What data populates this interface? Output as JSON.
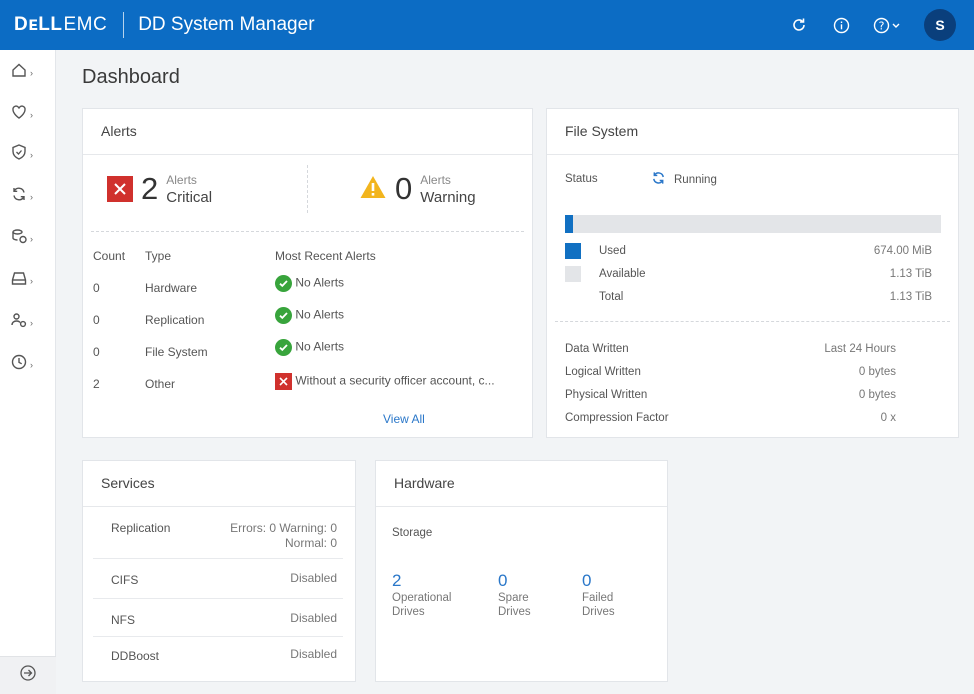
{
  "header": {
    "brand_dell": "DᴇLL",
    "brand_emc": "EMC",
    "app_title": "DD System Manager",
    "avatar_initial": "S",
    "icons": [
      "refresh-icon",
      "info-icon",
      "help-icon",
      "avatar"
    ]
  },
  "sidebar": {
    "items": [
      "home-icon",
      "health-icon",
      "security-icon",
      "replication-icon",
      "data-management-icon",
      "hardware-icon",
      "administration-icon",
      "maintenance-icon"
    ],
    "collapse_icon": "arrow-right-circle-icon"
  },
  "page_title": "Dashboard",
  "alerts": {
    "title": "Alerts",
    "critical": {
      "count": "2",
      "label_top": "Alerts",
      "label_bottom": "Critical"
    },
    "warning": {
      "count": "0",
      "label_top": "Alerts",
      "label_bottom": "Warning"
    },
    "columns": [
      "Count",
      "Type",
      "Most Recent Alerts"
    ],
    "rows": [
      {
        "count": "0",
        "type": "Hardware",
        "status": "ok",
        "text": "No Alerts"
      },
      {
        "count": "0",
        "type": "Replication",
        "status": "ok",
        "text": "No Alerts"
      },
      {
        "count": "0",
        "type": "File System",
        "status": "ok",
        "text": "No Alerts"
      },
      {
        "count": "2",
        "type": "Other",
        "status": "error",
        "text": "Without a security officer account, c..."
      }
    ],
    "view_all": "View All"
  },
  "file_system": {
    "title": "File System",
    "status_label": "Status",
    "status_value": "Running",
    "used_fraction": 0.02,
    "used_label": "Used",
    "used_value": "674.00 MiB",
    "available_label": "Available",
    "available_value": "1.13 TiB",
    "total_label": "Total",
    "total_value": "1.13 TiB",
    "colors": {
      "used": "#1170c2",
      "available": "#e3e5e8"
    },
    "stats": [
      {
        "label": "Data Written",
        "value": "Last 24 Hours"
      },
      {
        "label": "Logical Written",
        "value": "0 bytes"
      },
      {
        "label": "Physical Written",
        "value": "0 bytes"
      },
      {
        "label": "Compression Factor",
        "value": "0 x"
      }
    ]
  },
  "services": {
    "title": "Services",
    "rows": [
      {
        "name": "Replication",
        "status_line1": "Errors: 0 Warning: 0",
        "status_line2": "Normal: 0"
      },
      {
        "name": "CIFS",
        "status_line1": "Disabled"
      },
      {
        "name": "NFS",
        "status_line1": "Disabled"
      },
      {
        "name": "DDBoost",
        "status_line1": "Disabled"
      }
    ]
  },
  "hardware": {
    "title": "Hardware",
    "storage_label": "Storage",
    "drives": [
      {
        "count": "2",
        "line1": "Operational",
        "line2": "Drives"
      },
      {
        "count": "0",
        "line1": "Spare",
        "line2": "Drives"
      },
      {
        "count": "0",
        "line1": "Failed",
        "line2": "Drives"
      }
    ]
  }
}
